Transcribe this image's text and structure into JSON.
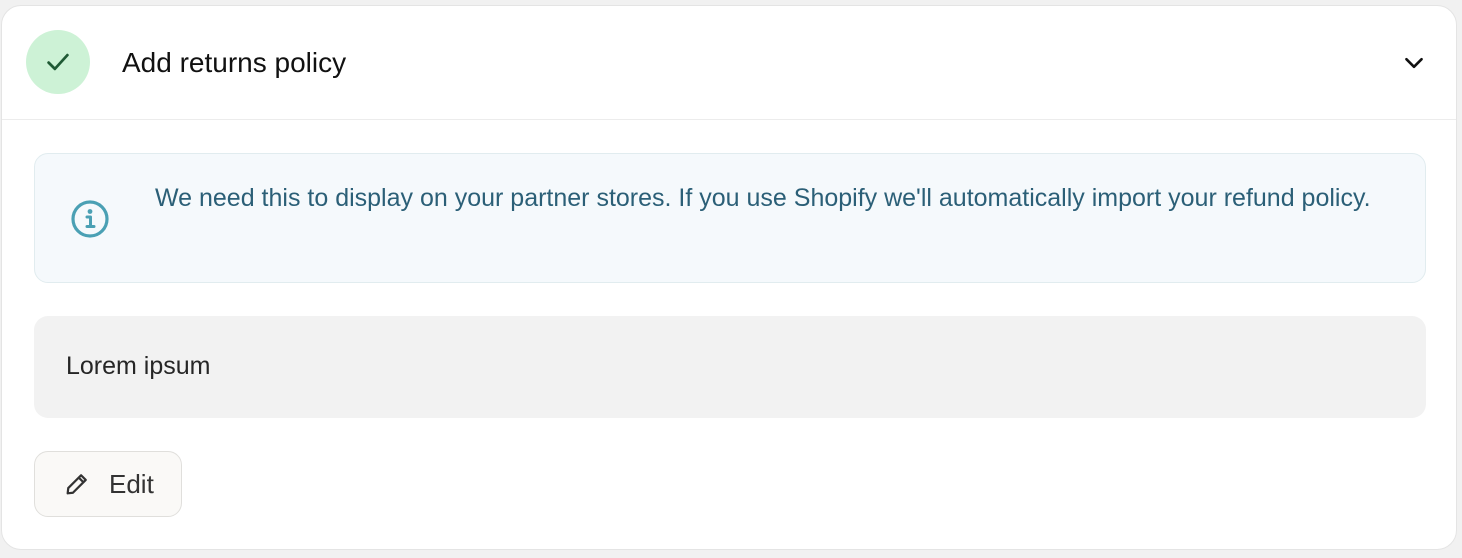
{
  "section": {
    "title": "Add returns policy",
    "status": "completed",
    "status_icon": "check-icon",
    "expand_icon": "chevron-down-icon",
    "colors": {
      "status_background": "#cdf2d6",
      "status_check": "#1f5a35"
    }
  },
  "info_banner": {
    "icon": "info-icon",
    "text": "We need this to display on your partner stores. If you use Shopify we'll automatically import your refund policy.",
    "colors": {
      "background": "#f5f9fc",
      "text": "#2b5f77",
      "icon": "#4aa0b4"
    }
  },
  "policy": {
    "text": "Lorem ipsum"
  },
  "actions": {
    "edit_label": "Edit",
    "edit_icon": "pencil-icon"
  }
}
